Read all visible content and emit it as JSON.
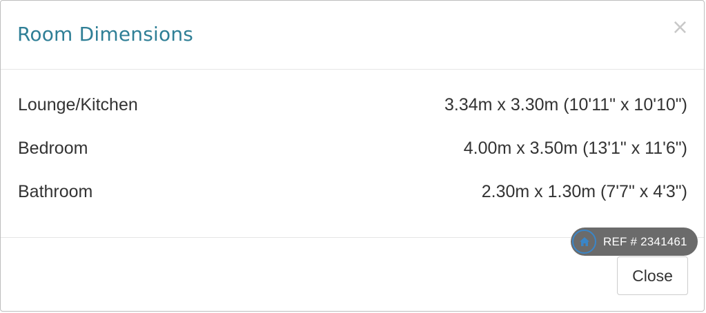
{
  "modal": {
    "title": "Room Dimensions",
    "close_symbol": "×",
    "close_button_label": "Close"
  },
  "rooms": [
    {
      "name": "Lounge/Kitchen",
      "dimensions": "3.34m x 3.30m (10'11\" x 10'10\")"
    },
    {
      "name": "Bedroom",
      "dimensions": "4.00m x 3.50m (13'1\" x 11'6\")"
    },
    {
      "name": "Bathroom",
      "dimensions": "2.30m x 1.30m (7'7\" x 4'3\")"
    }
  ],
  "ref_badge": {
    "icon": "home-icon",
    "text": "REF # 2341461"
  },
  "colors": {
    "title": "#2f7f96",
    "badge_background": "#6b6b6b",
    "badge_icon_ring": "#3a86c8"
  }
}
